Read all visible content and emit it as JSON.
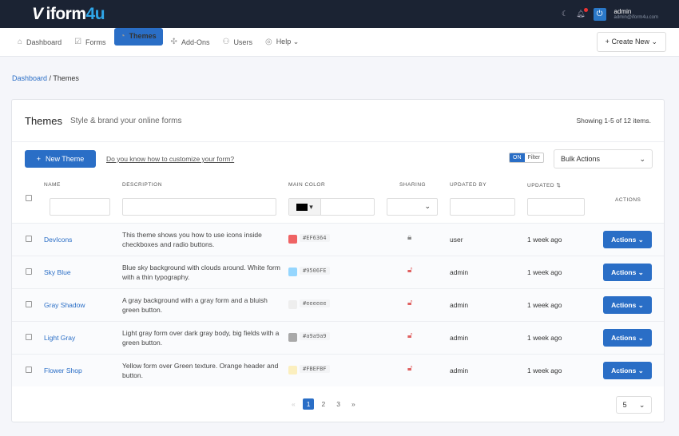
{
  "brand": {
    "name_prefix": "iform",
    "name_suffix": "4u"
  },
  "user": {
    "name": "admin",
    "email": "admin@iform4u.com"
  },
  "nav": [
    {
      "label": "Dashboard",
      "icon": "home-icon"
    },
    {
      "label": "Forms",
      "icon": "forms-icon"
    },
    {
      "label": "Themes",
      "icon": "palette-icon"
    },
    {
      "label": "Add-Ons",
      "icon": "puzzle-icon"
    },
    {
      "label": "Users",
      "icon": "users-icon"
    },
    {
      "label": "Help ⌄",
      "icon": "lifebuoy-icon"
    }
  ],
  "create_new": "Create New ⌄",
  "breadcrumb": {
    "home": "Dashboard",
    "current": "Themes"
  },
  "page": {
    "title": "Themes",
    "subtitle": "Style & brand your online forms",
    "showing": "Showing 1-5 of 12 items."
  },
  "toolbar": {
    "new_theme": "New Theme",
    "howto": "Do you know how to customize your form?",
    "toggle_on": "ON",
    "toggle_filter": "Filter",
    "bulk": "Bulk Actions"
  },
  "columns": {
    "name": "NAME",
    "description": "DESCRIPTION",
    "main_color": "MAIN COLOR",
    "sharing": "SHARING",
    "updated_by": "UPDATED BY",
    "updated": "UPDATED ⇅",
    "actions": "ACTIONS"
  },
  "rows": [
    {
      "name": "DevIcons",
      "description": "This theme shows you how to use icons inside checkboxes and radio buttons.",
      "color": "#EF6364",
      "locked": true,
      "updated_by": "user",
      "updated": "1 week ago",
      "action": "Actions ⌄"
    },
    {
      "name": "Sky Blue",
      "description": "Blue sky background with clouds around. White form with a thin typography.",
      "color": "#9506FE",
      "swatch": "#95D6FE",
      "locked": false,
      "updated_by": "admin",
      "updated": "1 week ago",
      "action": "Actions ⌄"
    },
    {
      "name": "Gray Shadow",
      "description": "A gray background with a gray form and a bluish green button.",
      "color": "#eeeeee",
      "locked": false,
      "updated_by": "admin",
      "updated": "1 week ago",
      "action": "Actions ⌄"
    },
    {
      "name": "Light Gray",
      "description": "Light gray form over dark gray body, big fields with a green button.",
      "color": "#a9a9a9",
      "locked": false,
      "updated_by": "admin",
      "updated": "1 week ago",
      "action": "Actions ⌄"
    },
    {
      "name": "Flower Shop",
      "description": "Yellow form over Green texture. Orange header and button.",
      "color": "#FBEFBF",
      "locked": false,
      "updated_by": "admin",
      "updated": "1 week ago",
      "action": "Actions ⌄"
    }
  ],
  "pagination": {
    "prev": "«",
    "pages": [
      "1",
      "2",
      "3"
    ],
    "next": "»",
    "current": "1",
    "per_page": "5"
  }
}
